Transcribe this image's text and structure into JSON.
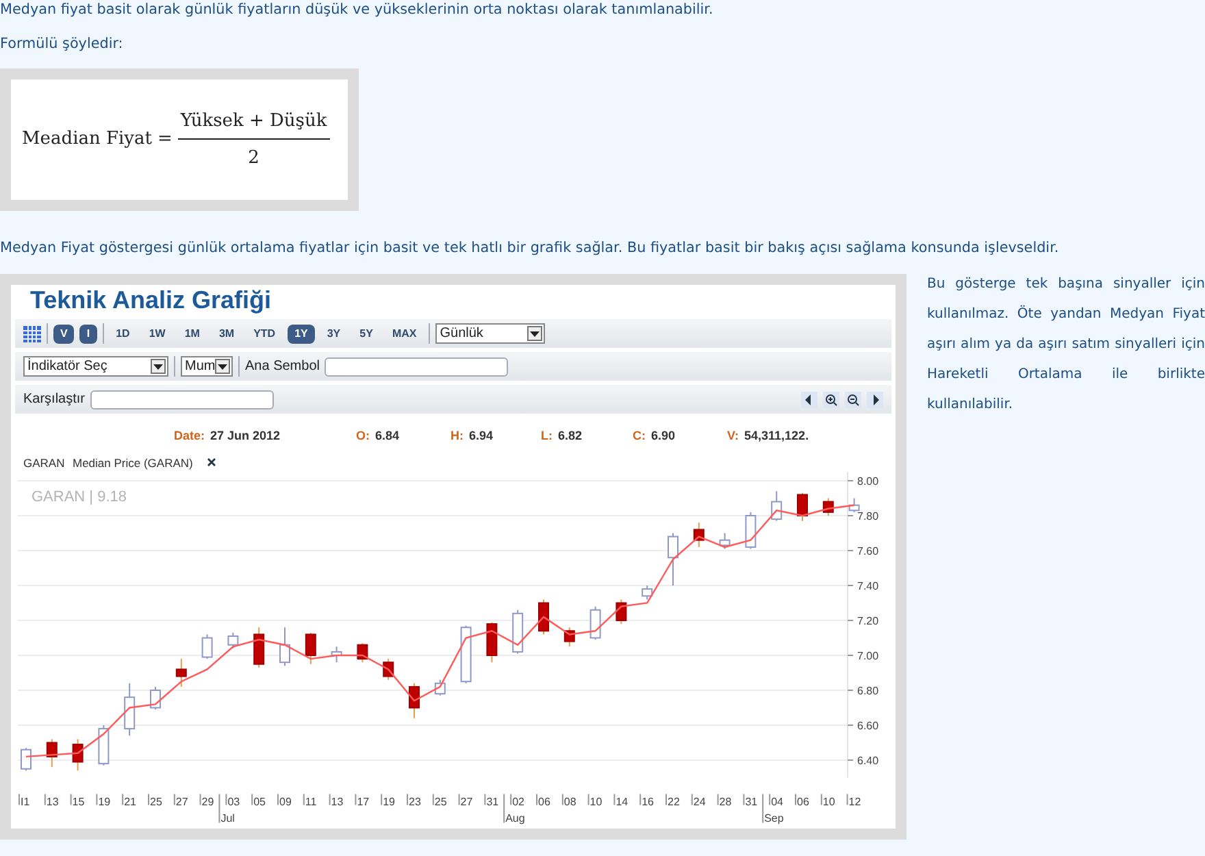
{
  "intro": "Medyan fiyat basit olarak günlük fiyatların düşük ve yükseklerinin orta noktası olarak tanımlanabilir.",
  "formula_label": "Formülü şöyledir:",
  "formula": {
    "lhs": "Meadian Fiyat",
    "equals": "=",
    "numerator": "Yüksek + Düşük",
    "denominator": "2"
  },
  "description": "Medyan Fiyat göstergesi günlük ortalama fiyatlar için basit ve tek hatlı bir grafik sağlar. Bu fiyatlar basit bir bakış açısı sağlama konsunda işlevseldir.",
  "chart_panel": {
    "title": "Teknik Analiz Grafiği",
    "view_buttons": [
      {
        "label": "V",
        "selected": true
      },
      {
        "label": "I",
        "selected": true
      }
    ],
    "range_buttons": [
      {
        "label": "1D",
        "selected": false
      },
      {
        "label": "1W",
        "selected": false
      },
      {
        "label": "1M",
        "selected": false
      },
      {
        "label": "3M",
        "selected": false
      },
      {
        "label": "YTD",
        "selected": false
      },
      {
        "label": "1Y",
        "selected": true
      },
      {
        "label": "3Y",
        "selected": false
      },
      {
        "label": "5Y",
        "selected": false
      },
      {
        "label": "MAX",
        "selected": false
      }
    ],
    "interval_select": {
      "value": "Günlük"
    },
    "indicator_select": {
      "value": "İndikatör Seç"
    },
    "type_select": {
      "value": "Mum"
    },
    "main_symbol": {
      "label": "Ana Sembol"
    },
    "compare": {
      "label": "Karşılaştır"
    },
    "info": [
      {
        "label": "Date:",
        "value": "27 Jun 2012"
      },
      {
        "label": "O:",
        "value": "6.84"
      },
      {
        "label": "H:",
        "value": "6.94"
      },
      {
        "label": "L:",
        "value": "6.82"
      },
      {
        "label": "C:",
        "value": "6.90"
      },
      {
        "label": "V:",
        "value": "54,311,122."
      }
    ],
    "legend": [
      {
        "label": "GARAN"
      }
    ],
    "symbol_label": "GARAN | 9.18",
    "chart_data": {
      "type": "candlestick",
      "grid": true,
      "categories": [
        "I1",
        "13",
        "15",
        "19",
        "21",
        "25",
        "27",
        "29",
        "03",
        "05",
        "09",
        "11",
        "13",
        "17",
        "19",
        "23",
        "25",
        "27",
        "31",
        "02",
        "06",
        "08",
        "10",
        "14",
        "16",
        "22",
        "24",
        "28",
        "31",
        "04",
        "06",
        "10",
        "12"
      ],
      "ylim": [
        6.3,
        8.05
      ],
      "ohlc": [
        [
          6.35,
          6.47,
          6.34,
          6.46
        ],
        [
          6.5,
          6.52,
          6.36,
          6.42
        ],
        [
          6.49,
          6.52,
          6.34,
          6.39
        ],
        [
          6.38,
          6.6,
          6.37,
          6.58
        ],
        [
          6.58,
          6.84,
          6.54,
          6.76
        ],
        [
          6.7,
          6.82,
          6.69,
          6.8
        ],
        [
          6.92,
          6.98,
          6.82,
          6.88
        ],
        [
          6.99,
          7.12,
          6.98,
          7.1
        ],
        [
          7.06,
          7.13,
          7.04,
          7.11
        ],
        [
          7.12,
          7.16,
          6.93,
          6.95
        ],
        [
          6.96,
          7.16,
          6.94,
          7.06
        ],
        [
          7.12,
          7.13,
          6.95,
          7.0
        ],
        [
          7.0,
          7.05,
          6.96,
          7.02
        ],
        [
          7.06,
          7.07,
          6.96,
          6.98
        ],
        [
          6.96,
          6.98,
          6.86,
          6.88
        ],
        [
          6.82,
          6.84,
          6.64,
          6.7
        ],
        [
          6.78,
          6.86,
          6.77,
          6.84
        ],
        [
          6.85,
          7.17,
          6.84,
          7.16
        ],
        [
          7.18,
          7.19,
          6.96,
          7.0
        ],
        [
          7.02,
          7.26,
          7.01,
          7.24
        ],
        [
          7.3,
          7.32,
          7.12,
          7.14
        ],
        [
          7.14,
          7.16,
          7.05,
          7.08
        ],
        [
          7.1,
          7.28,
          7.09,
          7.26
        ],
        [
          7.3,
          7.32,
          7.18,
          7.2
        ],
        [
          7.34,
          7.4,
          7.32,
          7.38
        ],
        [
          7.56,
          7.7,
          7.4,
          7.68
        ],
        [
          7.72,
          7.76,
          7.62,
          7.66
        ],
        [
          7.63,
          7.7,
          7.61,
          7.66
        ],
        [
          7.62,
          7.82,
          7.61,
          7.8
        ],
        [
          7.78,
          7.94,
          7.77,
          7.88
        ],
        [
          7.92,
          7.93,
          7.77,
          7.8
        ],
        [
          7.88,
          7.9,
          7.8,
          7.82
        ],
        [
          7.83,
          7.9,
          7.82,
          7.86
        ]
      ],
      "yticks": [
        {
          "value": 6.4,
          "label": "6.40"
        },
        {
          "value": 6.6,
          "label": "6.60"
        },
        {
          "value": 6.8,
          "label": "6.80"
        },
        {
          "value": 7.0,
          "label": "7.00"
        },
        {
          "value": 7.2,
          "label": "7.20"
        },
        {
          "value": 7.4,
          "label": "7.40"
        },
        {
          "value": 7.6,
          "label": "7.60"
        },
        {
          "value": 7.8,
          "label": "7.80"
        },
        {
          "value": 8.0,
          "label": "8.00"
        }
      ],
      "series": [
        {
          "name": "Median Price (GARAN)",
          "type": "line",
          "color": "#ff5a5a",
          "values": [
            6.42,
            6.43,
            6.44,
            6.55,
            6.7,
            6.72,
            6.85,
            6.92,
            7.05,
            7.09,
            7.06,
            6.98,
            7.0,
            7.0,
            6.92,
            6.74,
            6.82,
            7.1,
            7.14,
            7.06,
            7.22,
            7.12,
            7.14,
            7.28,
            7.3,
            7.55,
            7.68,
            7.62,
            7.66,
            7.83,
            7.8,
            7.84,
            7.86
          ]
        }
      ]
    },
    "month_labels": [
      "Jul",
      "Aug",
      "Sep"
    ]
  },
  "side_text": "Bu gösterge tek başına sinyaller için kullanılmaz. Öte yandan Medyan Fiyat aşırı alım ya da aşırı satım sinyalleri için Hareketli Ortalama ile birlikte kullanılabilir."
}
